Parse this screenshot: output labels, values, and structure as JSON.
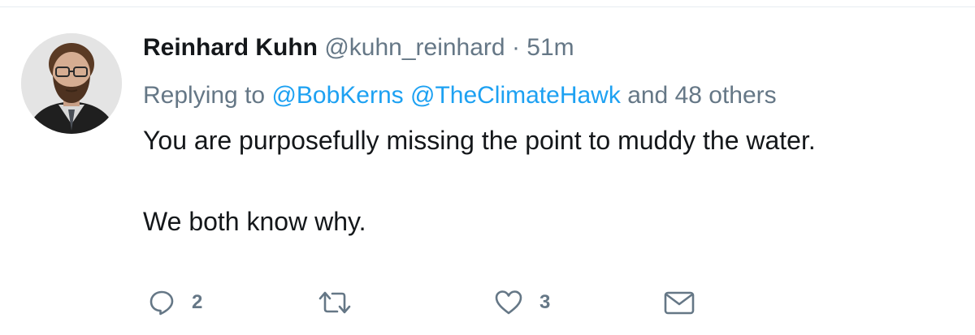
{
  "tweet": {
    "author_name": "Reinhard Kuhn",
    "handle": "@kuhn_reinhard",
    "separator": "·",
    "time": "51m",
    "replying_prefix": "Replying to",
    "mentions": [
      "@BobKerns",
      "@TheClimateHawk"
    ],
    "replying_suffix": "and 48 others",
    "text_lines": [
      "You are purposefully missing the point to muddy the water.",
      "We both know why."
    ]
  },
  "actions": {
    "reply": {
      "icon": "reply-icon",
      "count": "2"
    },
    "retweet": {
      "icon": "retweet-icon",
      "count": ""
    },
    "like": {
      "icon": "heart-icon",
      "count": "3"
    },
    "dm": {
      "icon": "envelope-icon"
    }
  },
  "colors": {
    "name": "#14171a",
    "secondary": "#657786",
    "link": "#1da1f2",
    "text": "#14171a",
    "divider": "#e6ecf0"
  }
}
